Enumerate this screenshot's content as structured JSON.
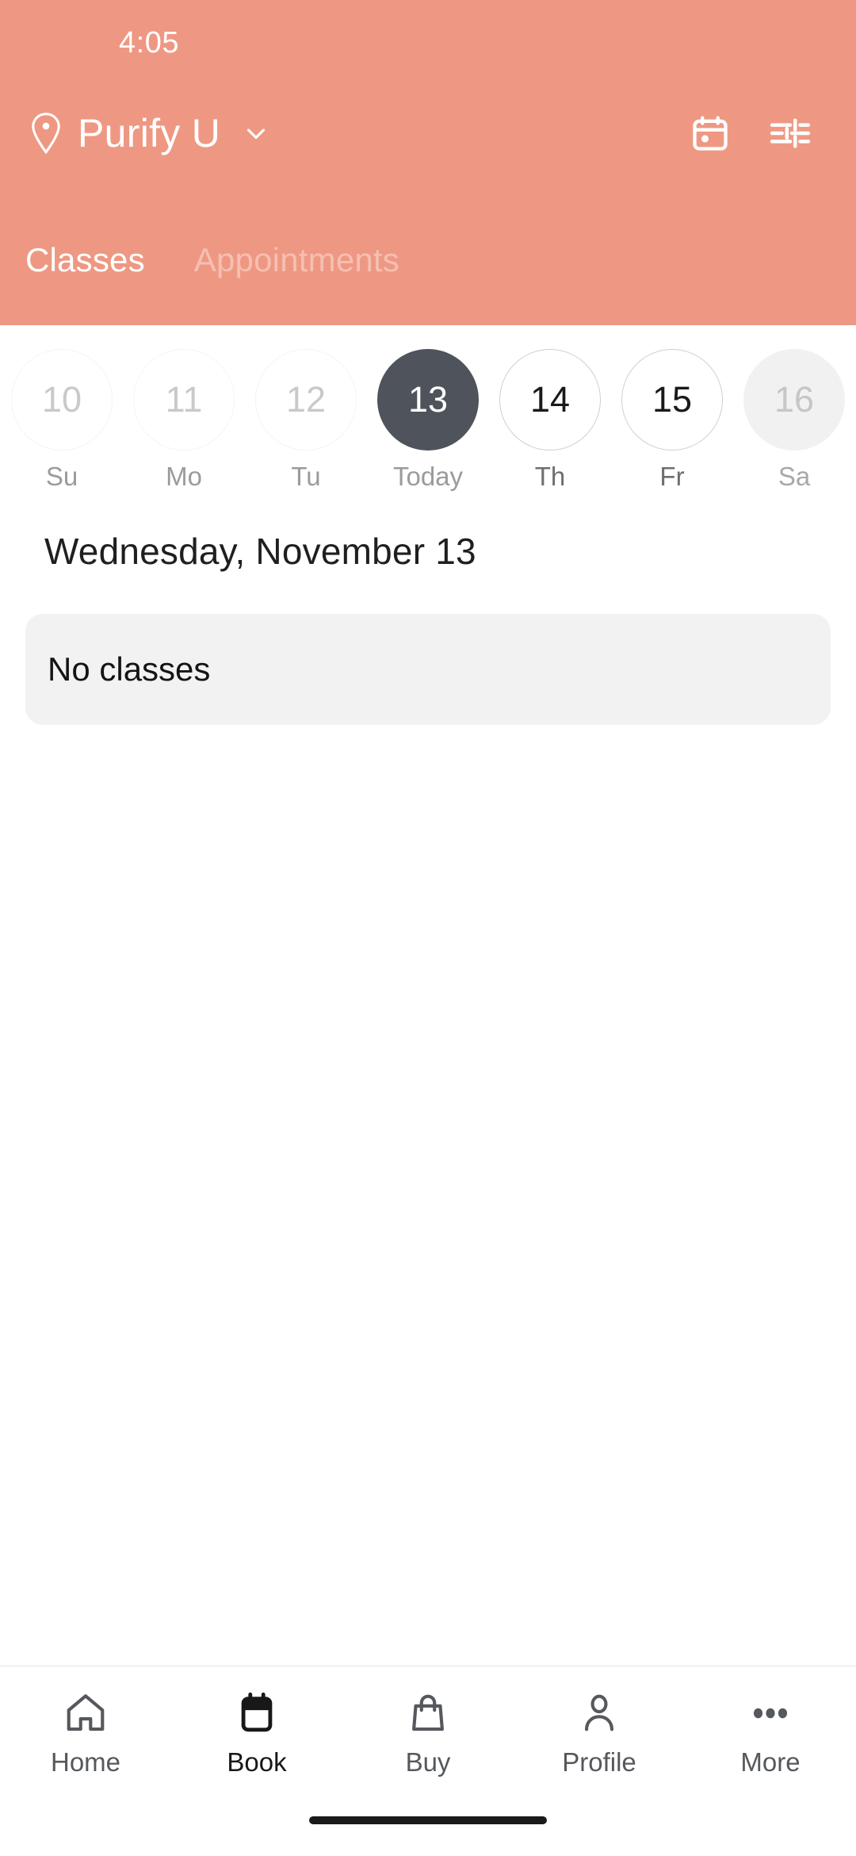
{
  "status_bar": {
    "time": "4:05"
  },
  "header": {
    "background_color": "#EE9883",
    "location": {
      "pin_icon": "location-pin-icon",
      "name": "Purify U",
      "chevron_icon": "chevron-down-icon"
    },
    "actions": [
      {
        "icon": "calendar-icon",
        "name": "calendar-button"
      },
      {
        "icon": "sliders-filter-icon",
        "name": "filter-button"
      }
    ],
    "tabs": [
      {
        "label": "Classes",
        "active": true
      },
      {
        "label": "Appointments",
        "active": false
      }
    ]
  },
  "date_strip": [
    {
      "day": "10",
      "label": "Su",
      "state": "past"
    },
    {
      "day": "11",
      "label": "Mo",
      "state": "past"
    },
    {
      "day": "12",
      "label": "Tu",
      "state": "past"
    },
    {
      "day": "13",
      "label": "Today",
      "state": "selected"
    },
    {
      "day": "14",
      "label": "Th",
      "state": "future"
    },
    {
      "day": "15",
      "label": "Fr",
      "state": "future"
    },
    {
      "day": "16",
      "label": "Sa",
      "state": "disabled"
    }
  ],
  "main": {
    "day_heading": "Wednesday, November 13",
    "empty_state": "No classes"
  },
  "bottom_nav": [
    {
      "label": "Home",
      "icon": "home-icon",
      "active": false
    },
    {
      "label": "Book",
      "icon": "calendar-filled-icon",
      "active": true
    },
    {
      "label": "Buy",
      "icon": "shopping-bag-icon",
      "active": false
    },
    {
      "label": "Profile",
      "icon": "person-icon",
      "active": false
    },
    {
      "label": "More",
      "icon": "ellipsis-icon",
      "active": false
    }
  ],
  "colors": {
    "accent": "#EE9883",
    "selected_day": "#4F535B",
    "card_background": "#F2F2F2",
    "tab_inactive": "#F6BFB2"
  }
}
